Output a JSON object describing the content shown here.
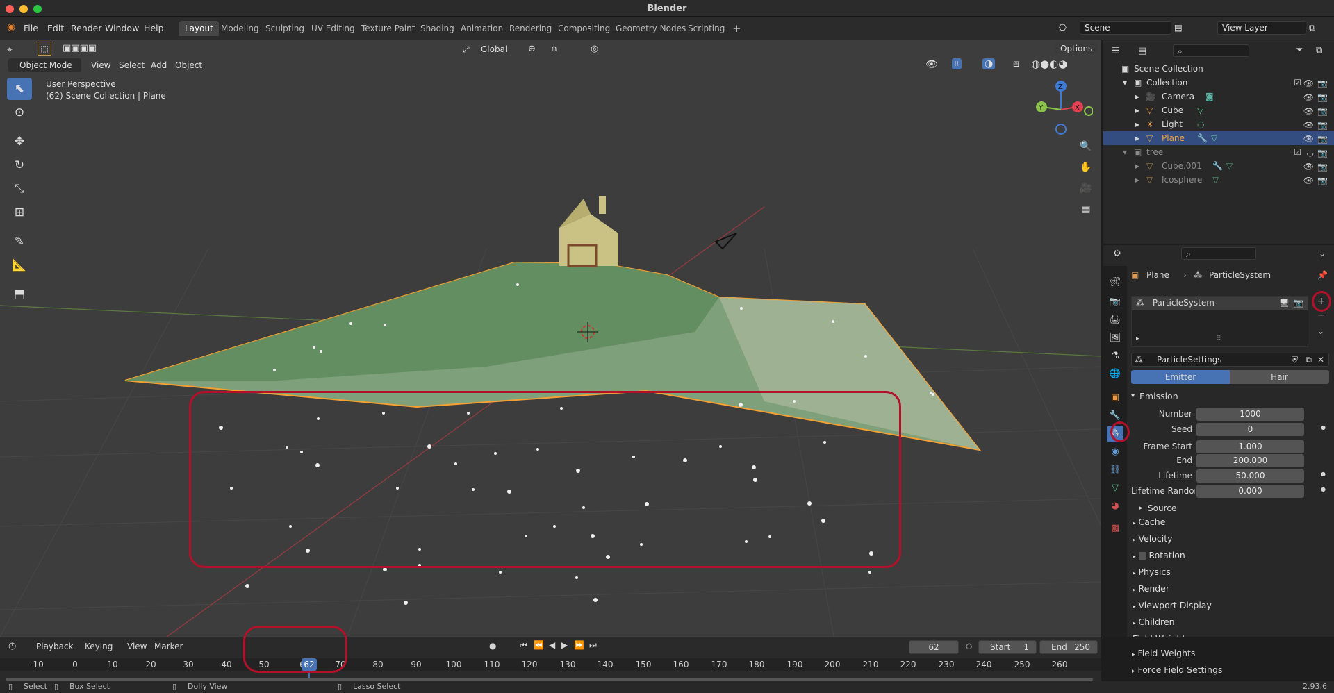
{
  "window": {
    "title": "Blender"
  },
  "menu": [
    "File",
    "Edit",
    "Render",
    "Window",
    "Help"
  ],
  "workspaces": [
    "Layout",
    "Modeling",
    "Sculpting",
    "UV Editing",
    "Texture Paint",
    "Shading",
    "Animation",
    "Rendering",
    "Compositing",
    "Geometry Nodes",
    "Scripting"
  ],
  "active_workspace": "Layout",
  "scene": {
    "name": "Scene",
    "view_layer": "View Layer"
  },
  "viewport": {
    "mode": "Object Mode",
    "menus": [
      "View",
      "Select",
      "Add",
      "Object"
    ],
    "orientation": "Global",
    "options_label": "Options",
    "overlay_line1": "User Perspective",
    "overlay_line2": "(62) Scene Collection | Plane",
    "gizmo_axes": [
      "Z",
      "Y",
      "X"
    ]
  },
  "outliner": {
    "root": "Scene Collection",
    "rows": [
      {
        "label": "Collection",
        "icon": "collection-icon"
      },
      {
        "label": "Camera",
        "icon": "camera-icon"
      },
      {
        "label": "Cube",
        "icon": "mesh-icon"
      },
      {
        "label": "Light",
        "icon": "light-icon"
      },
      {
        "label": "Plane",
        "icon": "mesh-icon"
      },
      {
        "label": "tree",
        "icon": "collection-icon"
      },
      {
        "label": "Cube.001",
        "icon": "mesh-icon"
      },
      {
        "label": "Icosphere",
        "icon": "mesh-icon"
      }
    ]
  },
  "properties": {
    "breadcrumb_object": "Plane",
    "breadcrumb_system": "ParticleSystem",
    "list_item": "ParticleSystem",
    "settings_name": "ParticleSettings",
    "type_emitter": "Emitter",
    "type_hair": "Hair",
    "emission_label": "Emission",
    "fields": [
      {
        "label": "Number",
        "value": "1000"
      },
      {
        "label": "Seed",
        "value": "0"
      },
      {
        "label": "Frame Start",
        "value": "1.000"
      },
      {
        "label": "End",
        "value": "200.000"
      },
      {
        "label": "Lifetime",
        "value": "50.000"
      },
      {
        "label": "Lifetime Randomn...",
        "value": "0.000"
      }
    ],
    "source_label": "Source",
    "panels": [
      "Cache",
      "Velocity",
      "Rotation",
      "Physics",
      "Render",
      "Viewport Display",
      "Children",
      "Field Weights",
      "Force Field Settings"
    ]
  },
  "timeline": {
    "menus": [
      "Playback",
      "Keying",
      "View",
      "Marker"
    ],
    "current_frame": "62",
    "start_label": "Start",
    "start": "1",
    "end_label": "End",
    "end": "250",
    "ticks": [
      "-10",
      "0",
      "10",
      "20",
      "30",
      "40",
      "50",
      "6",
      "70",
      "80",
      "90",
      "100",
      "110",
      "120",
      "130",
      "140",
      "150",
      "160",
      "170",
      "180",
      "190",
      "200",
      "210",
      "220",
      "230",
      "240",
      "250",
      "260"
    ]
  },
  "statusbar": {
    "select": "Select",
    "box_select": "Box Select",
    "dolly_view": "Dolly View",
    "lasso_select": "Lasso Select",
    "version": "2.93.6"
  },
  "colors": {
    "accent": "#4772b3",
    "selection_orange": "#f5a030",
    "annotation_red": "#b3102a"
  }
}
